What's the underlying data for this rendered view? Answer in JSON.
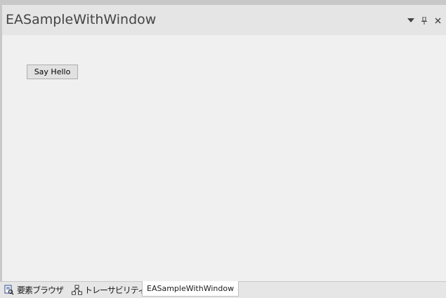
{
  "window": {
    "title": "EASampleWithWindow"
  },
  "header_controls": {
    "dropdown_icon": "chevron-down-icon",
    "pin_icon": "pin-icon",
    "close_icon": "close-icon"
  },
  "content": {
    "button_label": "Say Hello"
  },
  "tabs": [
    {
      "label": "要素ブラウザ",
      "icon": "element-browser-icon",
      "active": false
    },
    {
      "label": "トレーサビリティ",
      "icon": "traceability-icon",
      "active": false
    },
    {
      "label": "EASampleWithWindow",
      "icon": "",
      "active": true
    }
  ]
}
